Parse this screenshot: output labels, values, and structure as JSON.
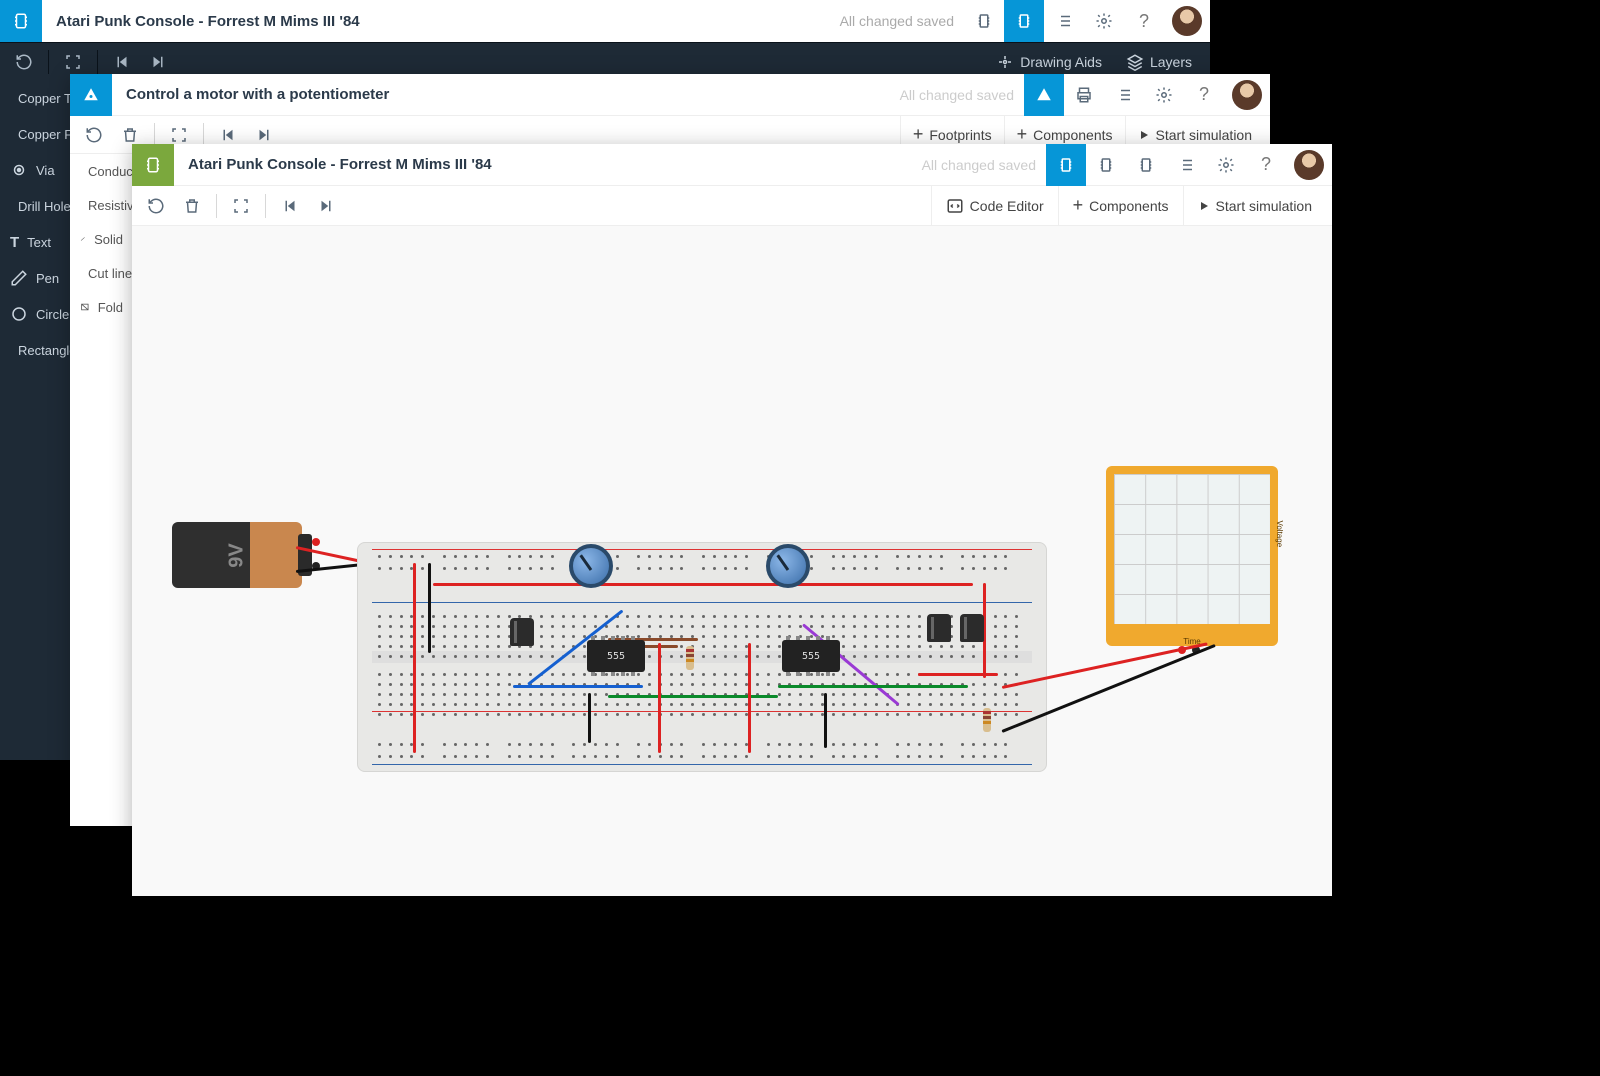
{
  "win1": {
    "title": "Atari Punk Console - Forrest M Mims III '84",
    "saved": "All changed saved",
    "drawing_aids": "Drawing Aids",
    "layers": "Layers",
    "left_tools": [
      "Copper Trace",
      "Copper Fill",
      "Via",
      "Drill Hole",
      "Text",
      "Pen",
      "Circle",
      "Rectangle"
    ]
  },
  "win2": {
    "title": "Control a motor with a potentiometer",
    "saved": "All changed saved",
    "footprints": "Footprints",
    "components": "Components",
    "start_sim": "Start simulation",
    "left_tools": [
      "Conductive",
      "Resistive",
      "Solid",
      "Cut line",
      "Fold"
    ]
  },
  "win3": {
    "title": "Atari Punk Console - Forrest M Mims III '84",
    "saved": "All changed saved",
    "code_editor": "Code Editor",
    "components": "Components",
    "start_sim": "Start simulation",
    "battery_label": "9V",
    "ic_label": "555",
    "scope_time": "Time",
    "scope_voltage": "Voltage"
  }
}
